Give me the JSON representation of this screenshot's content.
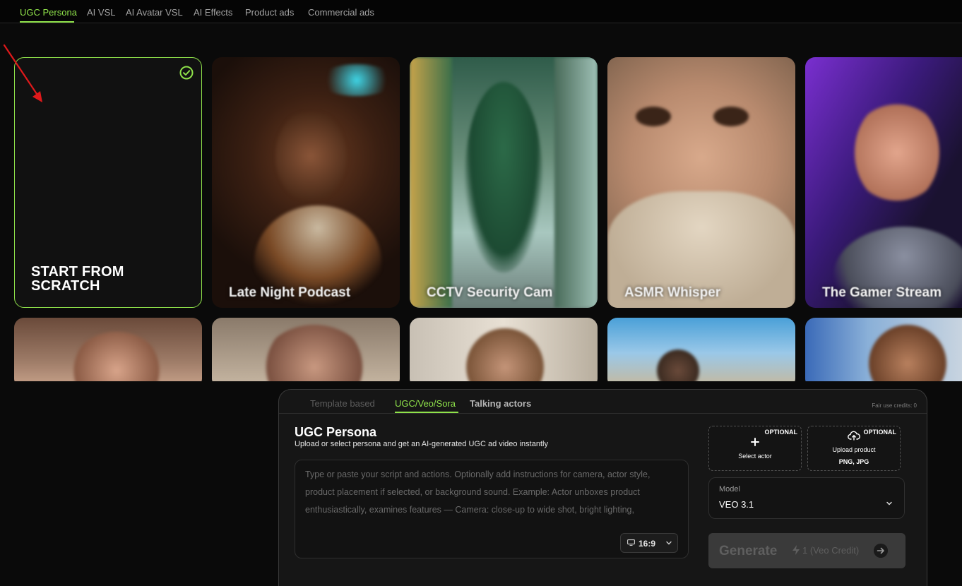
{
  "topnav": {
    "tabs": [
      "UGC Persona",
      "AI VSL",
      "AI Avatar VSL",
      "AI Effects",
      "Product ads",
      "Commercial ads"
    ],
    "active": "UGC Persona"
  },
  "grid": {
    "scratch_title_1": "START FROM",
    "scratch_title_2": "SCRATCH",
    "cards": [
      "Late Night Podcast",
      "CCTV Security Cam",
      "ASMR Whisper",
      "The Gamer Stream"
    ]
  },
  "panel": {
    "tabs": [
      "Template based",
      "UGC/Veo/Sora",
      "Talking actors"
    ],
    "active_tab": "UGC/Veo/Sora",
    "credits": "Fair use credits: 0",
    "title": "UGC Persona",
    "subtitle": "Upload or select persona and get an AI-generated UGC ad video instantly",
    "script_placeholder": "Type or paste your script and actions. Optionally add instructions for camera, actor style, product placement if selected, or background sound. Example: Actor unboxes product enthusiastically, examines features — Camera: close-up to wide shot, bright lighting,",
    "ratio": "16:9",
    "select_actor": {
      "tag": "OPTIONAL",
      "label": "Select actor"
    },
    "upload_product": {
      "tag": "OPTIONAL",
      "label": "Upload product",
      "formats": "PNG, JPG"
    },
    "model_label": "Model",
    "model_value": "VEO 3.1",
    "generate": {
      "label": "Generate",
      "cost": "1 (Veo Credit)"
    }
  },
  "colors": {
    "accent": "#8fe24a",
    "annotation_arrow": "#e0191b"
  },
  "icons": [
    "check-circle-icon",
    "arrow-annotation",
    "monitor-icon",
    "chevron-down-icon",
    "plus-icon",
    "cloud-upload-icon",
    "bolt-icon",
    "arrow-right-icon"
  ]
}
